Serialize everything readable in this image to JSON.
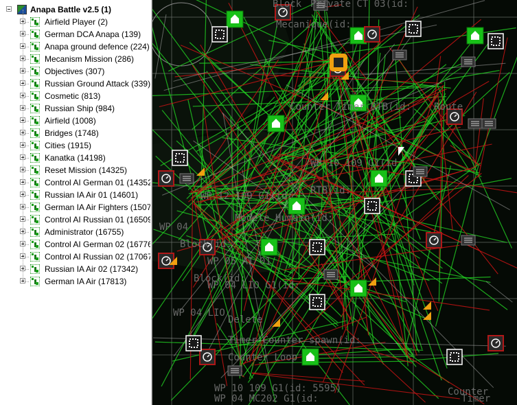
{
  "tree": {
    "root": {
      "label": "Anapa Battle v2.5 (1)",
      "icon": "mission-app-icon",
      "expanded": true
    },
    "items": [
      {
        "label": "Airfield Player (2)"
      },
      {
        "label": "German DCA Anapa (139)"
      },
      {
        "label": "Anapa ground defence (224)"
      },
      {
        "label": "Mecanism Mission (286)"
      },
      {
        "label": "Objectives (307)"
      },
      {
        "label": "Russian Ground Attack (339)"
      },
      {
        "label": "Cosmetic (813)"
      },
      {
        "label": "Russian Ship (984)"
      },
      {
        "label": "Airfield (1008)"
      },
      {
        "label": "Bridges (1748)"
      },
      {
        "label": "Cities (1915)"
      },
      {
        "label": "Kanatka (14198)"
      },
      {
        "label": "Reset Mission (14325)"
      },
      {
        "label": "Control AI German 01 (14352"
      },
      {
        "label": "Russian IA Air 01 (14601)"
      },
      {
        "label": "German IA Air Fighters (1507"
      },
      {
        "label": "Control AI Russian 01 (16509)"
      },
      {
        "label": "Administrator (16755)"
      },
      {
        "label": "Control AI German 02 (16776"
      },
      {
        "label": "Control AI Russian 02 (17067)"
      },
      {
        "label": "Russian IA Air 02 (17342)"
      },
      {
        "label": "German IA Air (17813)"
      }
    ]
  },
  "map": {
    "labels": [
      "Block",
      "Private CT 03(id:",
      "Mecanique(id:",
      "Counter Timer RTB(id:",
      "Route",
      "WP 10 109 G1(id:",
      "RTB(id:",
      "WP 12 109 G1(id:",
      "Modele Humain(id:",
      "WP 04",
      "Block(id:",
      "WP 05 AI 01",
      "Block(id:",
      "WP 04 LIO G1(id:",
      "WP 04 LIO",
      "Delete",
      "Timer Counter spawn(id:",
      "Counter Loop",
      "WP 10 109 G1(id: 5595)",
      "WP 04 MC202 G1(id:",
      "Counter",
      "Timer"
    ]
  },
  "colors": {
    "tree_bg": "#ffffff",
    "map_bg": "#050a05",
    "green_link": "#22d022",
    "red_link": "#c81414",
    "grid": "#6a706a",
    "green_block": "#18c018",
    "orange_marker": "#f0a010"
  }
}
